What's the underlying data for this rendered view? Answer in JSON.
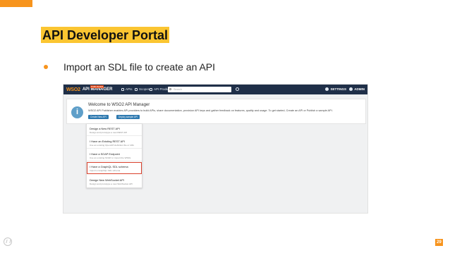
{
  "slide": {
    "title": "API Developer Portal",
    "bullet": "Import an SDL file to create an API",
    "page_number": "29"
  },
  "app": {
    "logo_brand": "WSO2",
    "logo_product": "API MANAGER",
    "badge": "PUBLISHER",
    "nav": [
      {
        "label": "APIs",
        "icon": "api-icon"
      },
      {
        "label": "Scopes",
        "icon": "scopes-icon"
      },
      {
        "label": "API Products",
        "icon": "products-icon"
      }
    ],
    "search_placeholder": "Search",
    "settings_label": "SETTINGS",
    "user_label": "ADMIN"
  },
  "welcome": {
    "title": "Welcome to WSO2 API Manager",
    "subtitle": "WSO2 API Publisher enables API providers to build APIs, share documentation, provision API keys and gather feedback on features, quality and usage. To get started, Create an API or Publish a sample API.",
    "create_button": "Create New API",
    "deploy_button": "Deploy sample API"
  },
  "menu": {
    "items": [
      {
        "title": "Design a New REST API",
        "desc": "Design and prototype a new REST API"
      },
      {
        "title": "I Have an Existing REST API",
        "desc": "Use an existing OpenAPI definition file or URL"
      },
      {
        "title": "I Have a SOAP Endpoint",
        "desc": "Use an existing SOAP or import the WSDL"
      },
      {
        "title": "I Have a GraphQL SDL schema",
        "desc": "Import a GraphQL SDL schema"
      },
      {
        "title": "Design New WebSocket API",
        "desc": "Design and prototype a new WebSocket API"
      }
    ],
    "selected_index": 3
  },
  "colors": {
    "accent": "#f7941d",
    "title_highlight": "#fbc531",
    "header": "#1f2f48",
    "highlight_border": "#d9402c"
  }
}
